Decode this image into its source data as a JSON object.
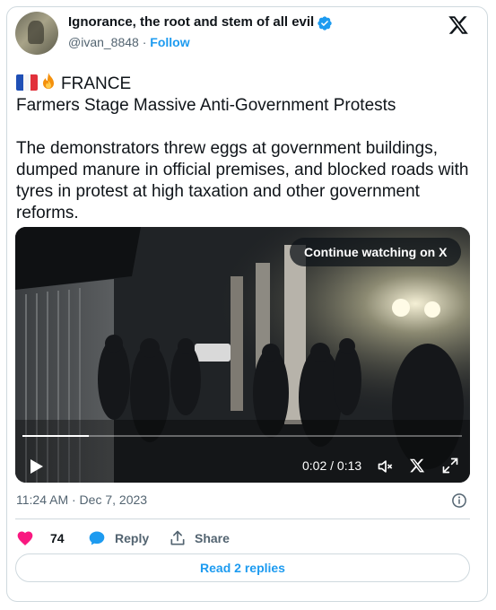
{
  "author": {
    "name": "Ignorance, the root and stem of all evil",
    "handle": "@ivan_8848",
    "separator": "·",
    "follow_label": "Follow"
  },
  "icons": {
    "verified": "verified-badge-icon",
    "x_logo": "x-logo-icon",
    "flag": "france-flag-emoji",
    "fire": "fire-emoji"
  },
  "post": {
    "line1": "FRANCE",
    "line2": "Farmers Stage Massive Anti-Government Protests",
    "paragraph": "The demonstrators threw eggs at government buildings, dumped manure in official premises, and blocked roads with tyres in protest at high taxation and other government reforms."
  },
  "video": {
    "continue_label": "Continue watching on X",
    "time": "0:02 / 0:13",
    "progress": 0.15
  },
  "timestamp": "11:24 AM · Dec 7, 2023",
  "actions": {
    "likes": "74",
    "reply_label": "Reply",
    "share_label": "Share"
  },
  "read_replies_label": "Read 2 replies",
  "colors": {
    "accent": "#1d9bf0",
    "like": "#f91880",
    "text": "#0f1419",
    "secondary": "#536471",
    "border": "#cfd9de"
  }
}
